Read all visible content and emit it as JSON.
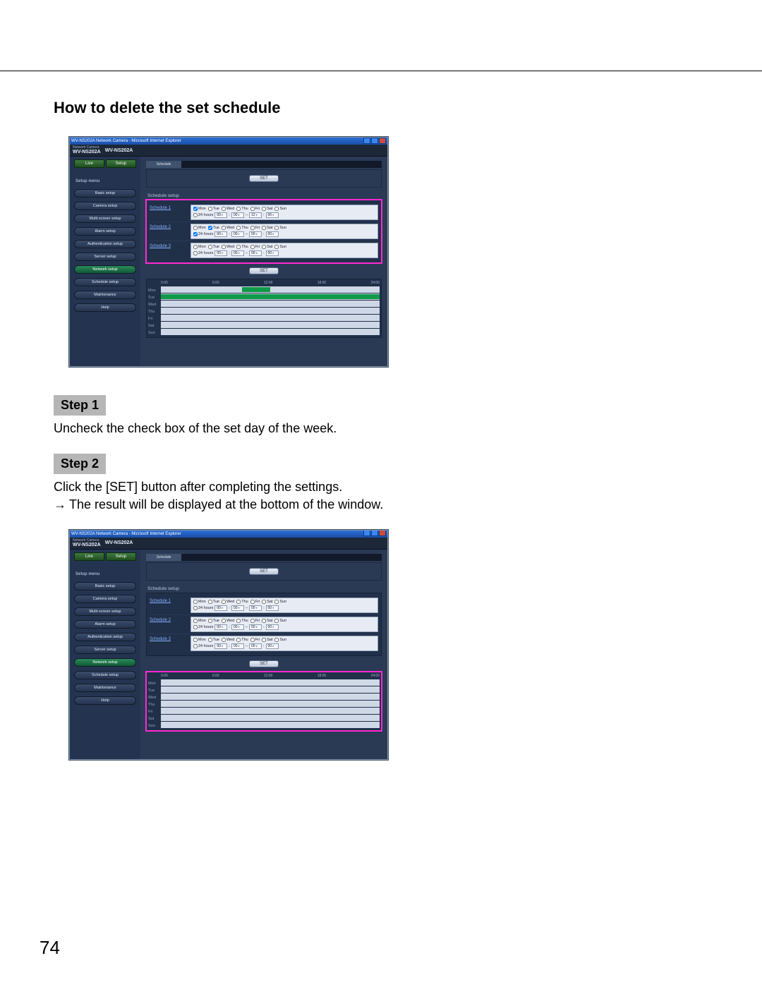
{
  "page": {
    "title": "How to delete the set schedule",
    "number": "74"
  },
  "steps": {
    "step1_label": "Step 1",
    "step1_text": "Uncheck the check box of the set day of the week.",
    "step2_label": "Step 2",
    "step2_text1": "Click the [SET] button after completing the settings.",
    "step2_arrow": "→",
    "step2_text2": "The result will be displayed at the bottom of the window."
  },
  "ui": {
    "ie_title": "WV-NS202A Network Camera - Microsoft Internet Explorer",
    "brand_small": "Network Camera",
    "brand_left": "WV-NS202A",
    "brand_right": "WV-NS202A",
    "tab_label": "Schedule",
    "live_btn": "Live",
    "setup_btn": "Setup",
    "menu_heading": "Setup menu",
    "menu": {
      "basic": "Basic setup",
      "camera": "Camera setup",
      "multiscreen": "Multi-screen setup",
      "alarm": "Alarm setup",
      "auth": "Authentication setup",
      "server": "Server setup",
      "network": "Network setup",
      "schedule": "Schedule setup",
      "maintenance": "Maintenance",
      "help": "Help"
    },
    "panel_title": "Schedule setup",
    "set_button": "SET",
    "days": [
      "Mon",
      "Tue",
      "Wed",
      "Thu",
      "Fri",
      "Sat",
      "Sun"
    ],
    "hours24": "24 hours",
    "timeline_ticks": [
      "0:00",
      "6:00",
      "12:00",
      "18:00",
      "24:00"
    ]
  },
  "screenshot1": {
    "schedules": [
      {
        "name": "Schedule 1",
        "days": [
          true,
          false,
          false,
          false,
          false,
          false,
          false
        ],
        "hours24": false,
        "time": [
          "09",
          "00",
          "12",
          "00"
        ]
      },
      {
        "name": "Schedule 2",
        "days": [
          false,
          true,
          false,
          false,
          false,
          false,
          false
        ],
        "hours24": true,
        "time": [
          "00",
          "00",
          "00",
          "00"
        ]
      },
      {
        "name": "Schedule 3",
        "days": [
          false,
          false,
          false,
          false,
          false,
          false,
          false
        ],
        "hours24": false,
        "time": [
          "00",
          "00",
          "00",
          "00"
        ]
      }
    ],
    "bars": {
      "Mon": {
        "start_pct": 37,
        "end_pct": 50
      },
      "Tue": {
        "start_pct": 0,
        "end_pct": 100
      }
    }
  },
  "screenshot2": {
    "schedules": [
      {
        "name": "Schedule 1",
        "days": [
          false,
          false,
          false,
          false,
          false,
          false,
          false
        ],
        "hours24": false,
        "time": [
          "00",
          "00",
          "00",
          "00"
        ]
      },
      {
        "name": "Schedule 2",
        "days": [
          false,
          false,
          false,
          false,
          false,
          false,
          false
        ],
        "hours24": false,
        "time": [
          "00",
          "00",
          "00",
          "00"
        ]
      },
      {
        "name": "Schedule 3",
        "days": [
          false,
          false,
          false,
          false,
          false,
          false,
          false
        ],
        "hours24": false,
        "time": [
          "00",
          "00",
          "00",
          "00"
        ]
      }
    ],
    "bars": {}
  }
}
